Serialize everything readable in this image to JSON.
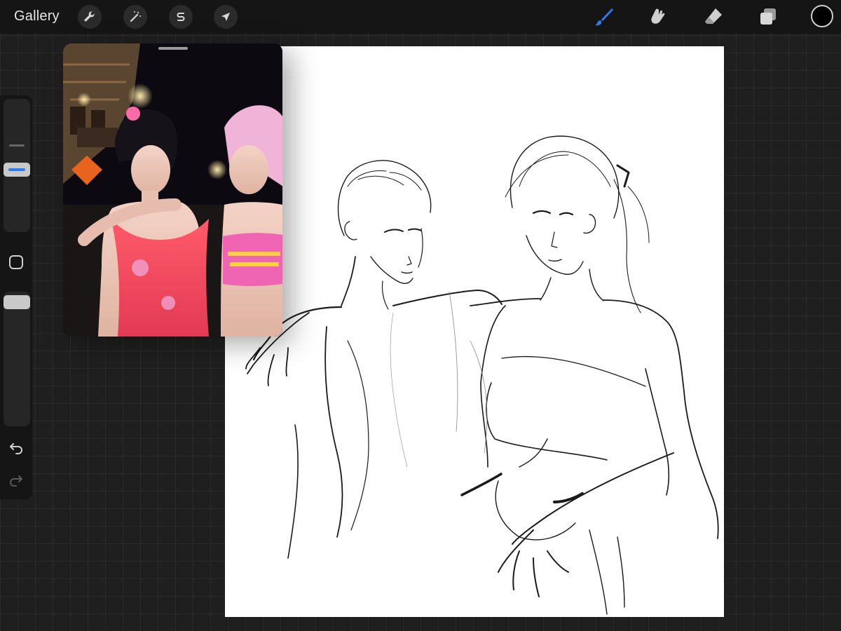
{
  "topbar": {
    "gallery_label": "Gallery",
    "left_tools": [
      "wrench-icon",
      "magic-wand-icon",
      "selection-s-icon",
      "transform-arrow-icon"
    ],
    "right_tools": [
      "brush-icon",
      "smudge-icon",
      "eraser-icon",
      "layers-icon"
    ],
    "active_tool": "brush",
    "current_color": "#000000",
    "accent_color": "#2d7df6"
  },
  "sidebar": {
    "brush_size": 0.5,
    "opacity": 1.0,
    "tools": [
      "modify-square-icon",
      "undo-icon",
      "redo-icon"
    ]
  },
  "canvas": {
    "background": "#ffffff"
  },
  "reference_window": {
    "description_icon": "reference-photo"
  }
}
